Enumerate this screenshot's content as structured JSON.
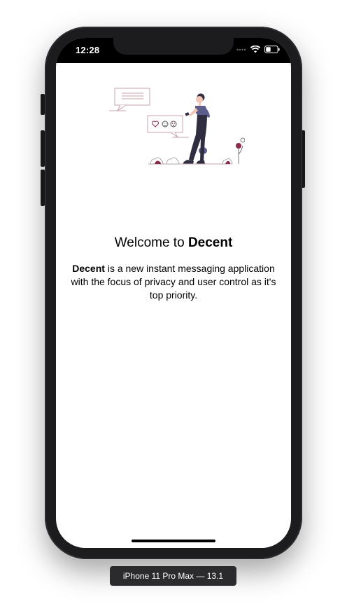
{
  "status_bar": {
    "time": "12:28",
    "icons": [
      "signal-dots-icon",
      "wifi-icon",
      "battery-icon"
    ]
  },
  "welcome": {
    "title_prefix": "Welcome to ",
    "title_app": "Decent",
    "description_app": "Decent",
    "description_rest": " is a new instant messaging application with the focus of privacy and user control as it's top priority."
  },
  "simulator": {
    "device_label": "iPhone 11 Pro Max — 13.1"
  },
  "colors": {
    "accent": "#8b2a4a",
    "figure_top": "#5b5d8a",
    "outline": "#c9a3ad"
  }
}
